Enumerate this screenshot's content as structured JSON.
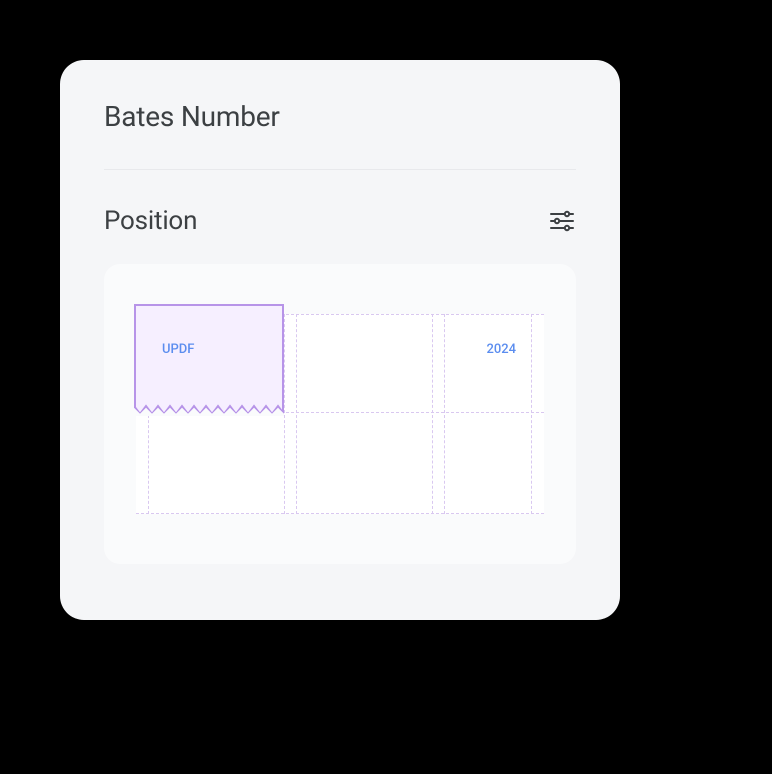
{
  "title": "Bates Number",
  "section": {
    "label": "Position"
  },
  "preview": {
    "topLeftLabel": "UPDF",
    "topRightLabel": "2024"
  }
}
